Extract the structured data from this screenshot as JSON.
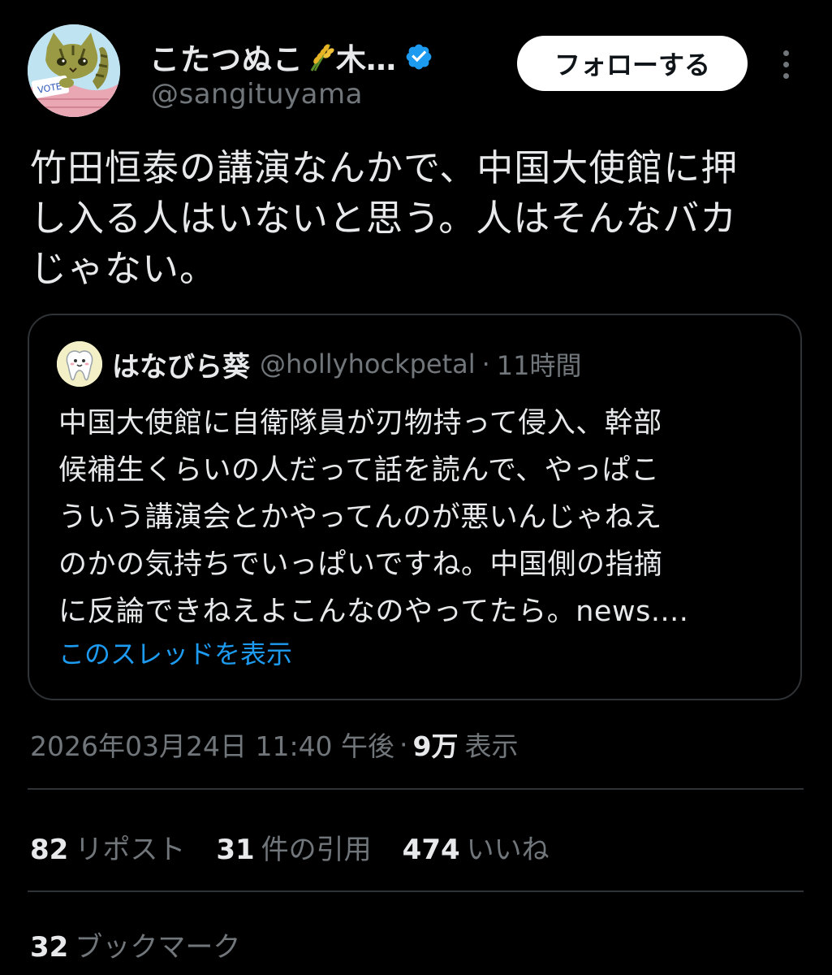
{
  "author": {
    "display_name": "こたつぬこ",
    "display_name_tail": "木…",
    "name_emoji": "rice-sheaf-icon",
    "verified_icon": "verified-badge-icon",
    "handle": "@sangituyama",
    "avatar": "cat-avatar"
  },
  "actions": {
    "follow_label": "フォローする",
    "more_icon": "more-options-icon"
  },
  "tweet": {
    "lines": [
      "竹田恒泰の講演なんかで、中国大使館に押",
      "し入る人はいないと思う。人はそんなバカ",
      "じゃない。"
    ]
  },
  "quoted": {
    "avatar": "tooth-avatar",
    "display_name": "はなびら葵",
    "handle": "@hollyhockpetal",
    "separator": "·",
    "time": "11時間",
    "lines": [
      "中国大使館に自衛隊員が刃物持って侵入、幹部",
      "候補生くらいの人だって話を読んで、やっぱこ",
      "ういう講演会とかやってんのが悪いんじゃねえ",
      "のかの気持ちでいっぱいですね。中国側の指摘",
      "に反論できねえよこんなのやってたら。news...."
    ],
    "show_thread": "このスレッドを表示"
  },
  "meta": {
    "timestamp": "2026年03月24日 11:40 午後",
    "separator": "·",
    "views_count": "9万",
    "views_label": "表示"
  },
  "stats": {
    "reposts_count": "82",
    "reposts_label": "リポスト",
    "quotes_count": "31",
    "quotes_label": "件の引用",
    "likes_count": "474",
    "likes_label": "いいね",
    "bookmarks_count": "32",
    "bookmarks_label": "ブックマーク"
  },
  "colors": {
    "background": "#000000",
    "text_primary": "#e7e9ea",
    "text_secondary": "#71767b",
    "link": "#1d9bf0",
    "border": "#2f3336",
    "verified": "#1d9bf0"
  }
}
